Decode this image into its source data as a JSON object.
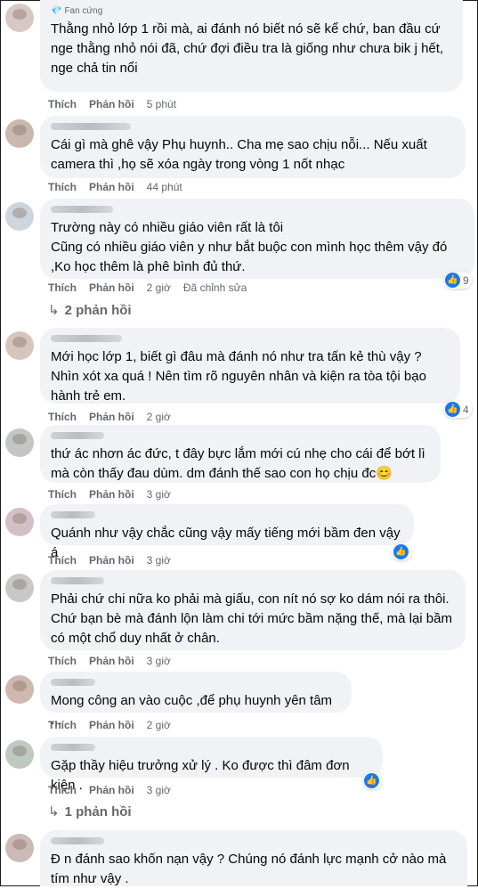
{
  "labels": {
    "like": "Thích",
    "reply": "Phản hồi",
    "edited": "Đã chỉnh sửa"
  },
  "comments": [
    {
      "badge": "Fan cứng",
      "text": "Thằng nhỏ lớp 1 rồi mà, ai đánh nó biết nó sẽ kể chứ, ban đầu cứ nge thằng nhỏ nói đã, chứ đợi điều tra là giống như chưa bik j hết, nge chả tin nổi",
      "time": "5 phút"
    },
    {
      "text": "Cái gì mà ghê vậy Phụ huynh.. Cha mẹ sao chịu nỗi... Nếu xuất camera thì ,họ sẽ xóa ngày trong vòng 1 nốt nhạc",
      "time": "44 phút"
    },
    {
      "text": "Trường này có nhiều giáo viên rất là tôi\nCũng có nhiều giáo viên y như bắt buộc con mình học thêm vậy đó ,Ko học thêm là phê bình đủ thứ.",
      "time": "2 giờ",
      "reaction_count": "9",
      "replies": "2 phản hồi"
    },
    {
      "text": "Mới học lớp 1, biết gì đâu mà đánh nó như tra tấn kẻ thù vậy ? Nhìn xót xa quá ! Nên tìm rõ nguyên nhân và kiện ra tòa tội bạo hành trẻ em.",
      "time": "2 giờ",
      "reaction_count": "4"
    },
    {
      "text": "thứ ác nhơn ác đức, t đây bực lắm mới cú nhẹ cho cái để bớt lì mà còn thấy đau dùm. dm đánh thế sao con họ chịu đc😊",
      "time": "3 giờ"
    },
    {
      "text": "Quánh như vậy chắc cũng vậy mấy tiếng mới bầm đen vậy á",
      "time": "3 giờ"
    },
    {
      "text": "Phải chứ chi nữa ko phải mà giấu, con nít nó sợ ko dám nói ra thôi. Chứ bạn bè mà đánh lộn làm chi tới mức bầm nặng thế, mà lại bầm có một chổ duy nhất ở chân.",
      "time": "3 giờ"
    },
    {
      "text": "Mong công an vào cuộc ,để phụ huynh yên tâm ...",
      "time": "2 giờ"
    },
    {
      "text": "Gặp thầy hiệu trưởng xử lý . Ko được thì đâm đơn kiện .",
      "time": "3 giờ",
      "replies": "1 phản hồi"
    },
    {
      "text": "Đ n đánh sao khốn nạn vậy ? Chúng nó đánh lực mạnh cở nào mà tím như vậy ."
    }
  ]
}
